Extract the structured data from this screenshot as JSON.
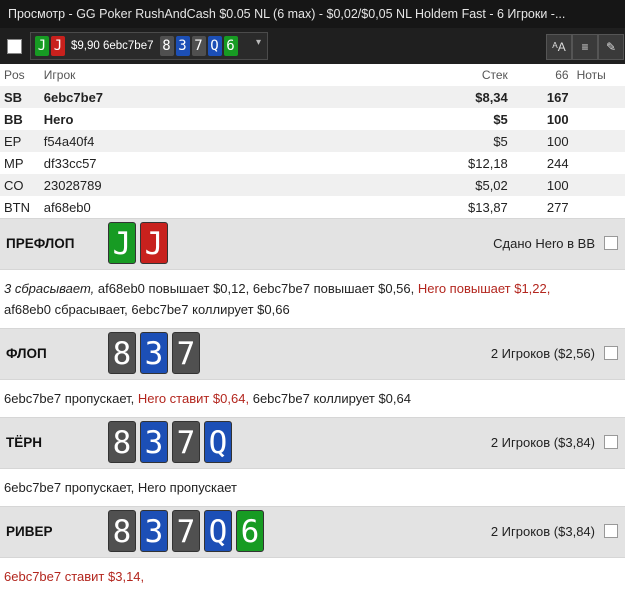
{
  "window": {
    "title": "Просмотр - GG Poker RushAndCash $0.05 NL (6 max) - $0,02/$0,05 NL Holdem Fast - 6 Игроки -..."
  },
  "toolbar": {
    "selector": {
      "hole_cards": [
        {
          "rank": "J",
          "color": "#179b23"
        },
        {
          "rank": "J",
          "color": "#c8211d"
        }
      ],
      "text": "$9,90 6ebc7be7",
      "board": [
        {
          "rank": "8",
          "color": "#505050"
        },
        {
          "rank": "3",
          "color": "#1c4fb6"
        },
        {
          "rank": "7",
          "color": "#505050"
        },
        {
          "rank": "Q",
          "color": "#1c4fb6"
        },
        {
          "rank": "6",
          "color": "#179b23"
        }
      ],
      "chevron": "▾"
    },
    "buttons": [
      {
        "name": "font-size-button",
        "icon": "font-size-icon",
        "glyph": "ᴬA"
      },
      {
        "name": "list-view-button",
        "icon": "list-icon",
        "glyph": "≡"
      },
      {
        "name": "edit-notes-button",
        "icon": "pencil-icon",
        "glyph": "✎"
      }
    ]
  },
  "players_table": {
    "headers": {
      "pos": "Pos",
      "player": "Игрок",
      "stack": "Стек",
      "col66": "66",
      "notes": "Ноты"
    },
    "rows": [
      {
        "pos": "SB",
        "player": "6ebc7be7",
        "stack": "$8,34",
        "col66": "167",
        "bold": true
      },
      {
        "pos": "BB",
        "player": "Hero",
        "stack": "$5",
        "col66": "100",
        "bold": true
      },
      {
        "pos": "EP",
        "player": "f54a40f4",
        "stack": "$5",
        "col66": "100",
        "bold": false
      },
      {
        "pos": "MP",
        "player": "df33cc57",
        "stack": "$12,18",
        "col66": "244",
        "bold": false
      },
      {
        "pos": "CO",
        "player": "23028789",
        "stack": "$5,02",
        "col66": "100",
        "bold": false
      },
      {
        "pos": "BTN",
        "player": "af68eb0",
        "stack": "$13,87",
        "col66": "277",
        "bold": false
      }
    ]
  },
  "streets": [
    {
      "name": "ПРЕФЛОП",
      "cards": [
        {
          "rank": "J",
          "color": "#179b23"
        },
        {
          "rank": "J",
          "color": "#c8211d"
        }
      ],
      "info": "Сдано Hero в BB",
      "actions": [
        {
          "text": "3 сбрасывает,",
          "style": "fold"
        },
        {
          "text": "af68eb0 повышает $0,12,",
          "style": "normal"
        },
        {
          "text": "6ebc7be7 повышает $0,56,",
          "style": "normal"
        },
        {
          "text": "Hero повышает $1,22,",
          "style": "hero"
        },
        {
          "text": "af68eb0 сбрасывает,",
          "style": "normal"
        },
        {
          "text": "6ebc7be7 коллирует $0,66",
          "style": "normal"
        }
      ]
    },
    {
      "name": "ФЛОП",
      "cards": [
        {
          "rank": "8",
          "color": "#505050"
        },
        {
          "rank": "3",
          "color": "#1c4fb6"
        },
        {
          "rank": "7",
          "color": "#505050"
        }
      ],
      "info": "2 Игроков ($2,56)",
      "actions": [
        {
          "text": "6ebc7be7 пропускает,",
          "style": "normal"
        },
        {
          "text": "Hero ставит $0,64,",
          "style": "hero"
        },
        {
          "text": "6ebc7be7 коллирует $0,64",
          "style": "normal"
        }
      ]
    },
    {
      "name": "ТЁРН",
      "cards": [
        {
          "rank": "8",
          "color": "#505050"
        },
        {
          "rank": "3",
          "color": "#1c4fb6"
        },
        {
          "rank": "7",
          "color": "#505050"
        },
        {
          "rank": "Q",
          "color": "#1c4fb6"
        }
      ],
      "info": "2 Игроков ($3,84)",
      "actions": [
        {
          "text": "6ebc7be7 пропускает,",
          "style": "normal"
        },
        {
          "text": "Hero пропускает",
          "style": "normal"
        }
      ]
    },
    {
      "name": "РИВЕР",
      "cards": [
        {
          "rank": "8",
          "color": "#505050"
        },
        {
          "rank": "3",
          "color": "#1c4fb6"
        },
        {
          "rank": "7",
          "color": "#505050"
        },
        {
          "rank": "Q",
          "color": "#1c4fb6"
        },
        {
          "rank": "6",
          "color": "#179b23"
        }
      ],
      "info": "2 Игроков ($3,84)",
      "actions": [
        {
          "text": "6ebc7be7 ставит $3,14,",
          "style": "hero"
        }
      ]
    }
  ]
}
